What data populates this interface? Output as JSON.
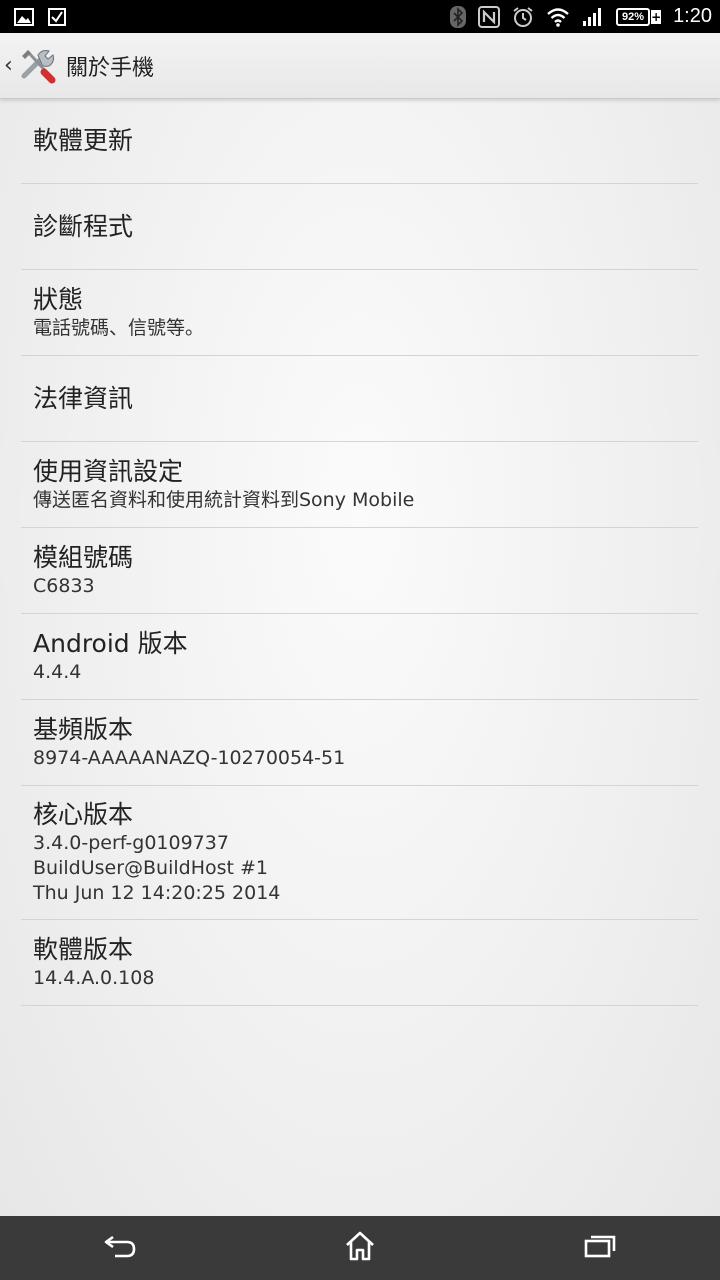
{
  "status_bar": {
    "left_icons": [
      "image-icon",
      "checkbox-icon"
    ],
    "right_icons": [
      "bluetooth-icon",
      "nfc-icon",
      "alarm-icon",
      "wifi-icon",
      "signal-icon"
    ],
    "battery_percent": "92%",
    "battery_charging_symbol": "+",
    "time": "1:20"
  },
  "action_bar": {
    "title": "關於手機",
    "app_icon": "tools-icon"
  },
  "items": [
    {
      "title": "軟體更新",
      "subtitle": ""
    },
    {
      "title": "診斷程式",
      "subtitle": ""
    },
    {
      "title": "狀態",
      "subtitle": "電話號碼、信號等。"
    },
    {
      "title": "法律資訊",
      "subtitle": ""
    },
    {
      "title": "使用資訊設定",
      "subtitle": "傳送匿名資料和使用統計資料到Sony Mobile"
    },
    {
      "title": "模組號碼",
      "subtitle": "C6833"
    },
    {
      "title": "Android 版本",
      "subtitle": "4.4.4"
    },
    {
      "title": "基頻版本",
      "subtitle": "8974-AAAAANAZQ-10270054-51"
    },
    {
      "title": "核心版本",
      "subtitle": "3.4.0-perf-g0109737\nBuildUser@BuildHost #1\nThu Jun 12 14:20:25 2014"
    },
    {
      "title": "軟體版本",
      "subtitle": "14.4.A.0.108"
    }
  ],
  "nav_bar": {
    "icons": [
      "back-icon",
      "home-icon",
      "recents-icon"
    ]
  }
}
